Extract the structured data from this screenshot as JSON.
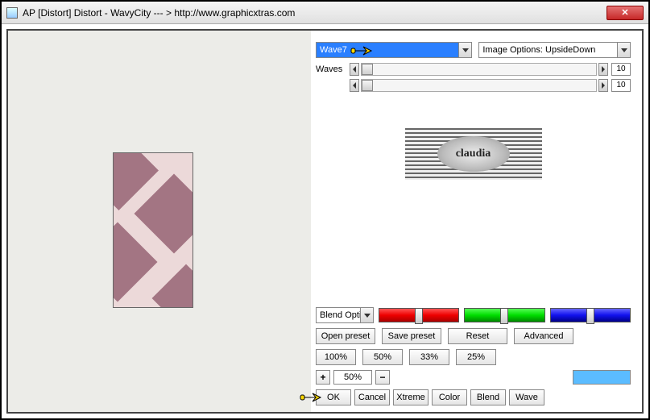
{
  "window": {
    "title": "AP [Distort]  Distort - WavyCity   --- > http://www.graphicxtras.com"
  },
  "preset_dropdown": {
    "selected": "Wave7"
  },
  "image_options_dropdown": {
    "selected": "Image Options: UpsideDown"
  },
  "waves": {
    "label": "Waves",
    "value1": "10",
    "value2": "10"
  },
  "logo_text": "claudia",
  "blend_dropdown": {
    "selected": "Blend Opti"
  },
  "preset_buttons": {
    "open": "Open preset",
    "save": "Save preset",
    "reset": "Reset",
    "advanced": "Advanced"
  },
  "zoom_presets": {
    "p100": "100%",
    "p50": "50%",
    "p33": "33%",
    "p25": "25%"
  },
  "zoom": {
    "plus": "+",
    "value": "50%",
    "minus": "−"
  },
  "final": {
    "ok": "OK",
    "cancel": "Cancel",
    "xtreme": "Xtreme",
    "color": "Color",
    "blend": "Blend",
    "wave": "Wave"
  }
}
